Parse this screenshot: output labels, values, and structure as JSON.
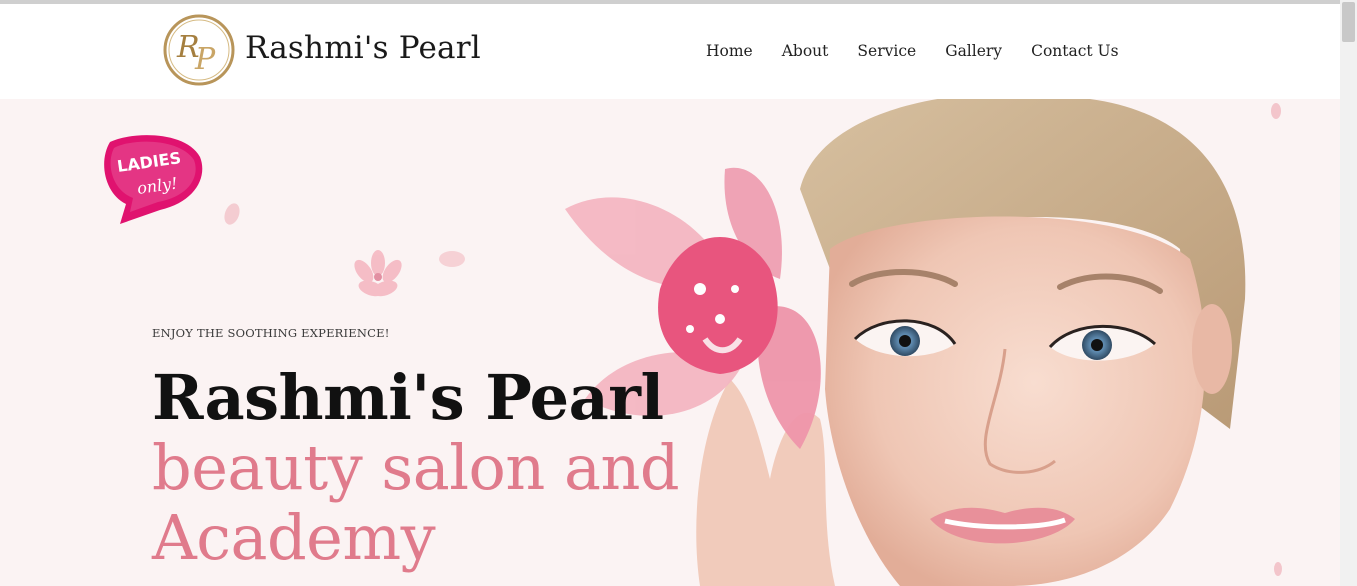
{
  "site": {
    "brand_name": "Rashmi's Pearl",
    "logo_monogram": "RP"
  },
  "nav": {
    "items": [
      {
        "label": "Home"
      },
      {
        "label": "About"
      },
      {
        "label": "Service"
      },
      {
        "label": "Gallery"
      },
      {
        "label": "Contact Us"
      }
    ]
  },
  "hero": {
    "eyebrow": "ENJOY THE SOOTHING EXPERIENCE!",
    "title_line1": "Rashmi's Pearl",
    "title_line2": "beauty salon and",
    "title_line3": "Academy",
    "badge_line1": "LADIES",
    "badge_line2": "only!"
  },
  "colors": {
    "accent_pink": "#e07b8c",
    "badge_magenta": "#e0126f",
    "logo_gold": "#b8955a",
    "hero_bg": "#fbf3f3"
  },
  "icons": {
    "logo": "rp-monogram-logo",
    "badge": "ladies-only-badge"
  }
}
